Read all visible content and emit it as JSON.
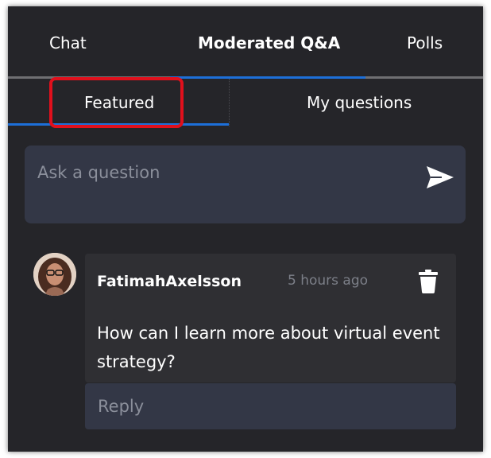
{
  "tabs": [
    {
      "label": "Chat"
    },
    {
      "label": "Moderated Q&A"
    },
    {
      "label": "Polls"
    }
  ],
  "subtabs": [
    {
      "label": "Featured"
    },
    {
      "label": "My questions"
    }
  ],
  "ask": {
    "placeholder": "Ask a question",
    "send_icon": "send-icon"
  },
  "question_card": {
    "author": "FatimahAxelsson",
    "time": "5 hours ago",
    "text": "How can I learn more about virtual event strategy?",
    "delete_icon": "trash-icon"
  },
  "reply": {
    "placeholder": "Reply"
  },
  "colors": {
    "background": "#252529",
    "active_tab_underline": "#1d6fd8",
    "input_background": "#333746",
    "highlight_border": "#e0101c"
  }
}
